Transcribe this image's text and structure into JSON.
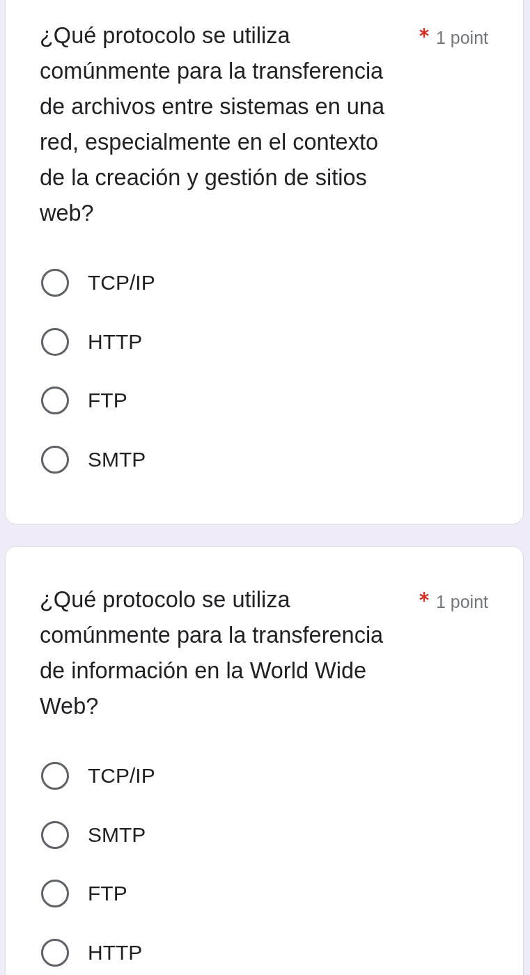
{
  "questions": [
    {
      "title": "¿Qué protocolo se utiliza comúnmente para la transferencia de archivos entre sistemas en una red, especialmente en el contexto de la creación y gestión de sitios web?",
      "required": true,
      "points": "1 point",
      "options": [
        {
          "label": "TCP/IP",
          "selected": false
        },
        {
          "label": "HTTP",
          "selected": false
        },
        {
          "label": "FTP",
          "selected": false
        },
        {
          "label": "SMTP",
          "selected": false
        }
      ]
    },
    {
      "title": "¿Qué protocolo se utiliza comúnmente para la transferencia de información en la World Wide Web?",
      "required": true,
      "points": "1 point",
      "options": [
        {
          "label": "TCP/IP",
          "selected": false
        },
        {
          "label": "SMTP",
          "selected": false
        },
        {
          "label": "FTP",
          "selected": false
        },
        {
          "label": "HTTP",
          "selected": false
        }
      ]
    }
  ]
}
